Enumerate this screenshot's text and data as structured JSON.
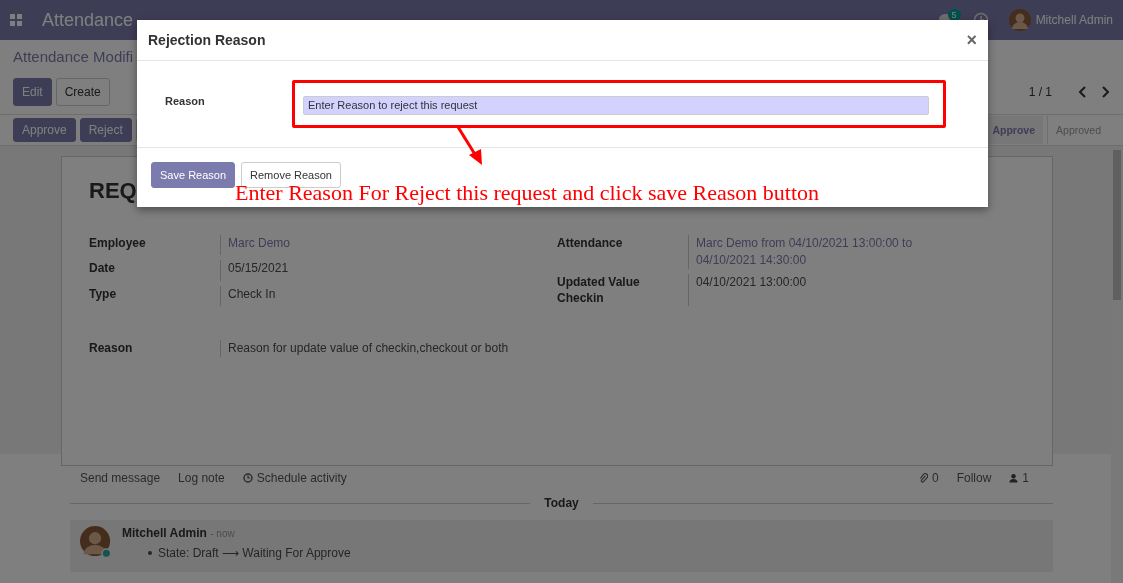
{
  "navbar": {
    "app_name": "Attendance",
    "chat_count": "5",
    "user": "Mitchell Admin"
  },
  "control_panel": {
    "breadcrumb": "Attendance Modifi",
    "buttons": [
      {
        "label": "Edit",
        "kind": "primary"
      },
      {
        "label": "Create",
        "kind": "secondary"
      }
    ],
    "pager": "1 / 1"
  },
  "header": {
    "buttons": [
      "Approve",
      "Reject"
    ],
    "stages": [
      {
        "label": "Approve",
        "selected": true
      },
      {
        "label": "Approved",
        "selected": false
      }
    ]
  },
  "sheet": {
    "title": "REQ",
    "left_fields": [
      {
        "label": "Employee",
        "value": "Marc Demo",
        "link": true
      },
      {
        "label": "Date",
        "value": "05/15/2021",
        "link": false
      },
      {
        "label": "Type",
        "value": "Check In",
        "link": false
      }
    ],
    "right_fields": [
      {
        "label": "Attendance",
        "value": "Marc Demo from 04/10/2021 13:00:00 to 04/10/2021 14:30:00",
        "link": true
      },
      {
        "label": "Updated Value Checkin",
        "value": "04/10/2021 13:00:00",
        "link": false
      }
    ],
    "reason": {
      "label": "Reason",
      "value": "Reason for update value of checkin,checkout or both"
    }
  },
  "chatter": {
    "actions": [
      "Send message",
      "Log note",
      "Schedule activity"
    ],
    "attachments": "0",
    "follow": "Follow",
    "followers": "1",
    "date_divider": "Today",
    "message": {
      "author": "Mitchell Admin",
      "time": "- now",
      "items": [
        "State: Draft ⟶ Waiting For Approve"
      ]
    }
  },
  "dialog": {
    "title": "Rejection Reason",
    "close": "×",
    "field_label": "Reason",
    "placeholder": "Enter Reason to reject this request",
    "buttons": [
      {
        "label": "Save Reason",
        "kind": "primary"
      },
      {
        "label": "Remove Reason",
        "kind": "secondary"
      }
    ]
  },
  "annotation": {
    "text": "Enter Reason For Reject this request and click save Reason button"
  }
}
